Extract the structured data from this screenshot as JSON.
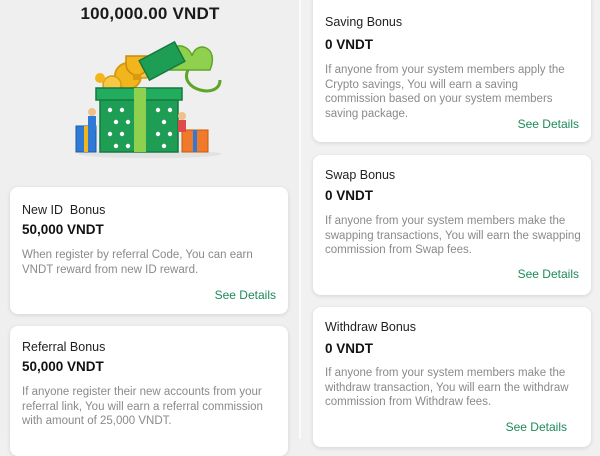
{
  "header": {
    "total": "100,000.00 VNDT"
  },
  "cards_left": [
    {
      "title": "New ID  Bonus",
      "amount": "50,000 VNDT",
      "description": "When register by referral Code, You can earn VNDT reward from new ID reward.",
      "link": "See Details"
    },
    {
      "title": "Referral Bonus",
      "amount": "50,000 VNDT",
      "description": "If anyone register their new accounts from your referral link, You will earn a referral commission with amount of 25,000 VNDT.",
      "link": "See Details"
    }
  ],
  "cards_right": [
    {
      "title": "Saving Bonus",
      "amount": "0 VNDT",
      "description": "If anyone from your system members apply the Crypto savings, You will earn a saving commission based on your system members saving package.",
      "link": "See Details"
    },
    {
      "title": "Swap Bonus",
      "amount": "0 VNDT",
      "description": "If anyone from your system members make the swapping transactions, You will earn the swapping commission from Swap fees.",
      "link": "See Details"
    },
    {
      "title": "Withdraw Bonus",
      "amount": "0 VNDT",
      "description": "If anyone from your system members make the withdraw transaction, You will earn the withdraw commission from Withdraw fees.",
      "link": "See Details"
    }
  ],
  "colors": {
    "accent": "#1d8a5a",
    "gift_green": "#1e9e55",
    "ribbon": "#8fd14f",
    "gold": "#f2b51c"
  },
  "illustration": {
    "icon": "gift-box-with-coins-icon"
  }
}
